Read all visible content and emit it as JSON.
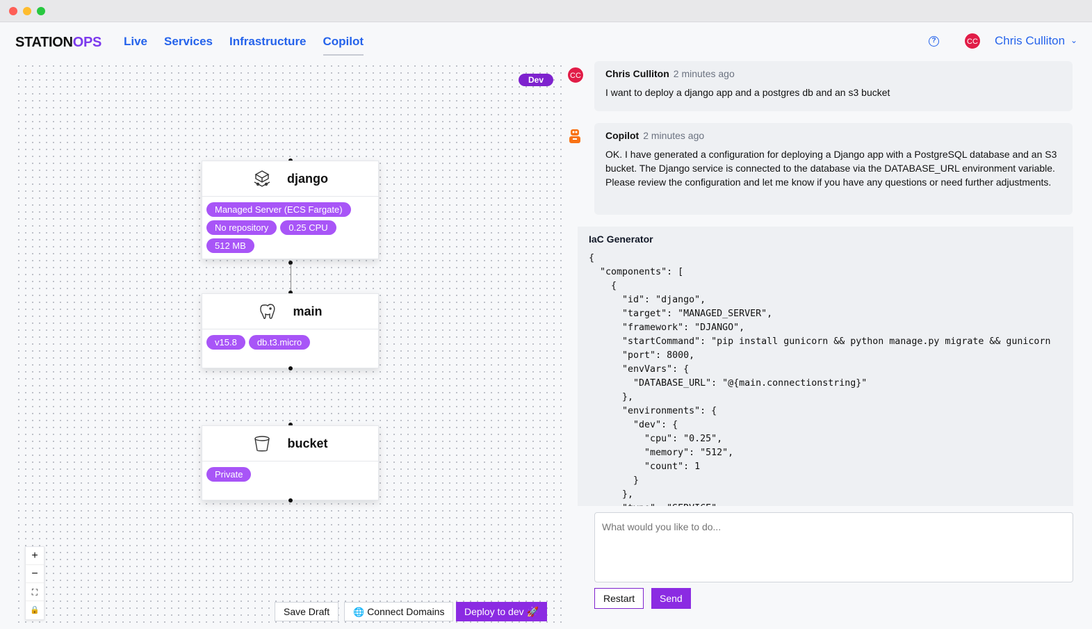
{
  "header": {
    "logo_part1": "STATION",
    "logo_part2": "OPS",
    "nav": [
      {
        "label": "Live"
      },
      {
        "label": "Services"
      },
      {
        "label": "Infrastructure"
      },
      {
        "label": "Copilot",
        "active": true
      }
    ],
    "help_icon": "question-circle-icon",
    "user_initials": "CC",
    "user_name": "Chris Culliton"
  },
  "canvas": {
    "environment_badge": "Dev",
    "nodes": [
      {
        "title": "django",
        "icon": "server-cube-icon",
        "tags": [
          "Managed Server (ECS Fargate)",
          "No repository",
          "0.25 CPU",
          "512 MB"
        ]
      },
      {
        "title": "main",
        "icon": "postgres-elephant-icon",
        "tags": [
          "v15.8",
          "db.t3.micro"
        ]
      },
      {
        "title": "bucket",
        "icon": "bucket-icon",
        "tags": [
          "Private"
        ]
      }
    ],
    "zoom_controls": [
      "+",
      "−",
      "⛶",
      "🔒"
    ],
    "save_draft_label": "Save Draft",
    "connect_domains_label": "Connect Domains",
    "deploy_label": "Deploy to dev 🚀"
  },
  "chat": {
    "messages": [
      {
        "author": "Chris Culliton",
        "initials": "CC",
        "time": "2 minutes ago",
        "text": "I want to deploy a django app and a postgres db and an s3 bucket"
      },
      {
        "author": "Copilot",
        "time": "2 minutes ago",
        "text": "OK. I have generated a configuration for deploying a Django app with a PostgreSQL database and an S3 bucket. The Django service is connected to the database via the DATABASE_URL environment variable. Please review the configuration and let me know if you have any questions or need further adjustments."
      }
    ],
    "iac_title": "IaC Generator",
    "iac_code": "{\n  \"components\": [\n    {\n      \"id\": \"django\",\n      \"target\": \"MANAGED_SERVER\",\n      \"framework\": \"DJANGO\",\n      \"startCommand\": \"pip install gunicorn && python manage.py migrate && gunicorn\n      \"port\": 8000,\n      \"envVars\": {\n        \"DATABASE_URL\": \"@{main.connectionstring}\"\n      },\n      \"environments\": {\n        \"dev\": {\n          \"cpu\": \"0.25\",\n          \"memory\": \"512\",\n          \"count\": 1\n        }\n      },\n      \"type\": \"SERVICE\"",
    "prompt_placeholder": "What would you like to do...",
    "restart_label": "Restart",
    "send_label": "Send"
  }
}
